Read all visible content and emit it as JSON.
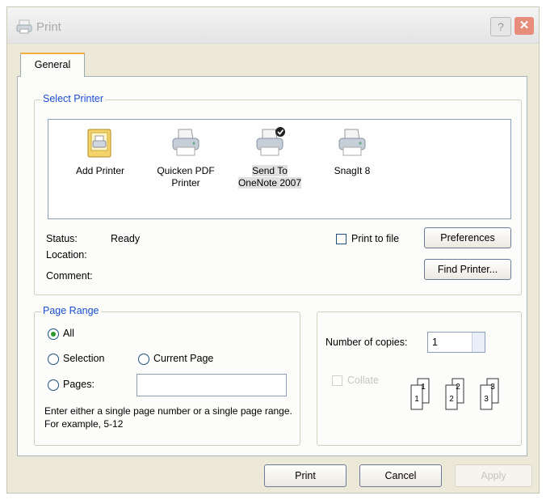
{
  "window": {
    "title": "Print",
    "help_glyph": "?",
    "close_glyph": "✕"
  },
  "tabs": [
    {
      "label": "General",
      "selected": true
    }
  ],
  "select_printer": {
    "legend": "Select Printer",
    "printers": [
      {
        "name_line1": "Add Printer",
        "name_line2": "",
        "icon": "add-printer-icon",
        "selected": false
      },
      {
        "name_line1": "Quicken PDF",
        "name_line2": "Printer",
        "icon": "printer-icon",
        "selected": false
      },
      {
        "name_line1": "Send To",
        "name_line2": "OneNote 2007",
        "icon": "default-printer-icon",
        "selected": true
      },
      {
        "name_line1": "SnagIt 8",
        "name_line2": "",
        "icon": "printer-icon",
        "selected": false
      }
    ],
    "status_label": "Status:",
    "status_value": "Ready",
    "location_label": "Location:",
    "location_value": "",
    "comment_label": "Comment:",
    "comment_value": "",
    "print_to_file_label": "Print to file",
    "print_to_file_checked": false,
    "preferences_label": "Preferences",
    "find_printer_label": "Find Printer..."
  },
  "page_range": {
    "legend": "Page Range",
    "all_label": "All",
    "selection_label": "Selection",
    "current_page_label": "Current Page",
    "pages_label": "Pages:",
    "pages_value": "",
    "selected": "All",
    "hint": "Enter either a single page number or a single page range.  For example, 5-12"
  },
  "copies": {
    "number_label": "Number of copies:",
    "number_value": "1",
    "collate_label": "Collate",
    "collate_enabled": false,
    "collate_pages": [
      "1",
      "1",
      "2",
      "2",
      "3",
      "3"
    ]
  },
  "footer": {
    "print_label": "Print",
    "cancel_label": "Cancel",
    "apply_label": "Apply"
  },
  "colors": {
    "legend": "#1a4fd0",
    "dialog_bg": "#ece9d8",
    "tab_accent": "#f0b040"
  }
}
